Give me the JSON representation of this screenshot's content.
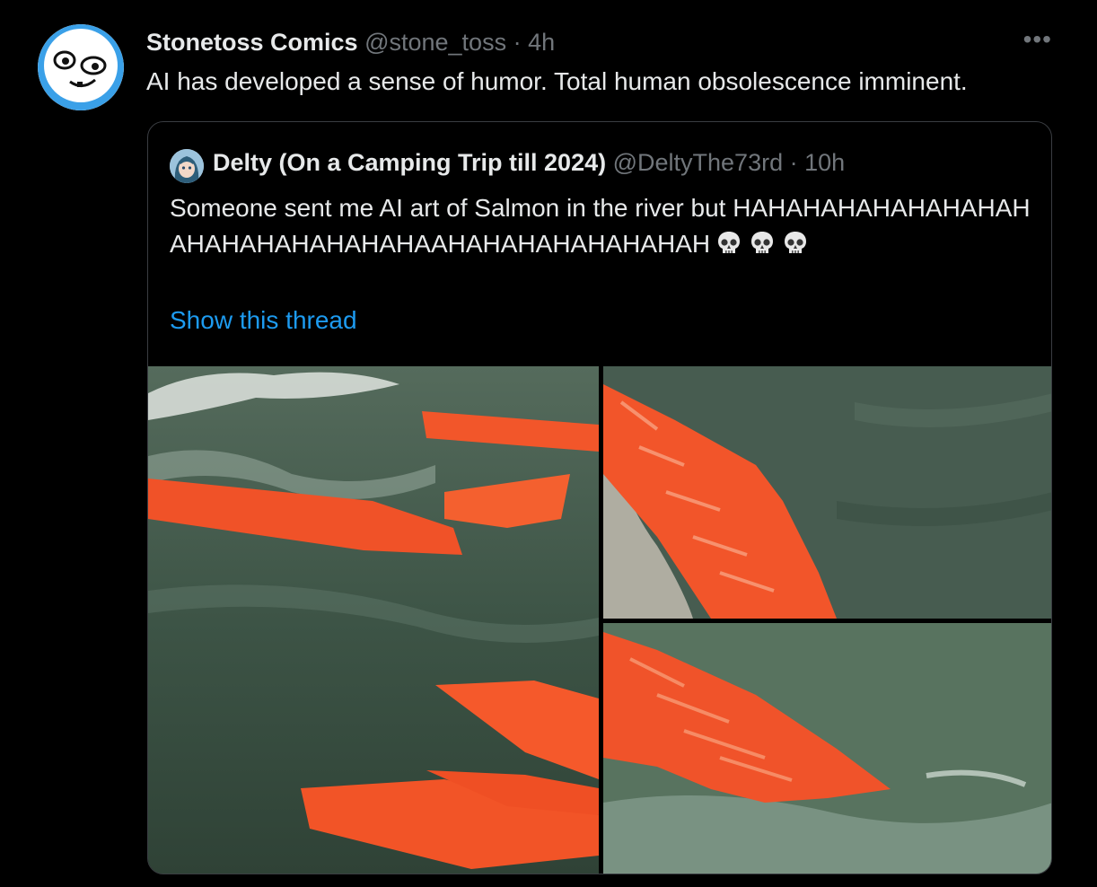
{
  "tweet": {
    "author_name": "Stonetoss Comics",
    "handle": "@stone_toss",
    "separator": "·",
    "time": "4h",
    "more_label": "•••",
    "text": "AI has developed a sense of humor. Total human obsolescence imminent."
  },
  "quoted": {
    "author_name": "Delty (On a Camping Trip till 2024)",
    "handle": "@DeltyThe73rd",
    "separator": "·",
    "time": "10h",
    "text": "Someone sent me AI art of Salmon in the river but HAHAHAHAHAHAHAHAHAHAHAHAHAHAHAHAAHAHAHAHAHAHAHAH",
    "emoji": [
      "skull-emoji",
      "skull-emoji",
      "skull-emoji"
    ],
    "show_thread_label": "Show this thread"
  },
  "media": {
    "count": 3,
    "images": [
      "salmon-fillets-in-river-image",
      "salmon-fillet-rapids-image",
      "salmon-fillet-water-image"
    ]
  },
  "colors": {
    "background": "#000000",
    "text": "#e7e9ea",
    "muted": "#71767b",
    "link": "#1d9bf0",
    "border": "#3a3d42",
    "salmon": "#f2562a"
  }
}
